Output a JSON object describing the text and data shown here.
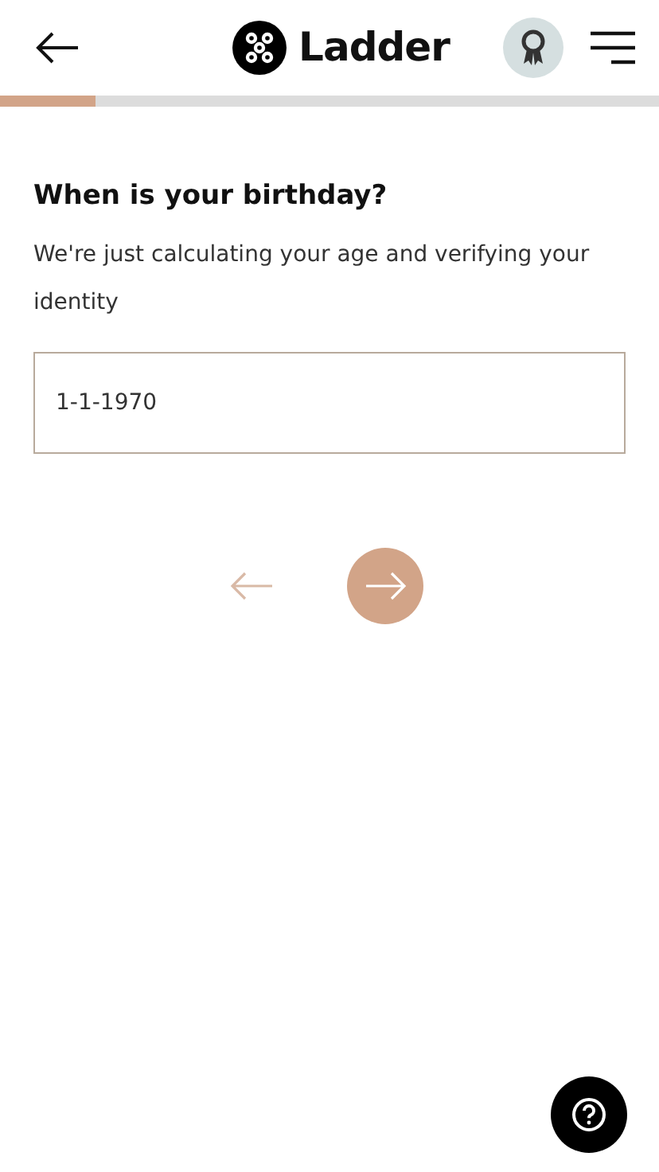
{
  "header": {
    "logo_text": "Ladder"
  },
  "progress": {
    "level": 0.145
  },
  "question": {
    "title": "When is your birthday?",
    "description": "We're just calculating your age and verifying your identity"
  },
  "birthday_field": {
    "value": "1-1-1970"
  },
  "navigation": {
    "previous": {
      "disabled": true
    },
    "next": {
      "disabled": false
    }
  }
}
